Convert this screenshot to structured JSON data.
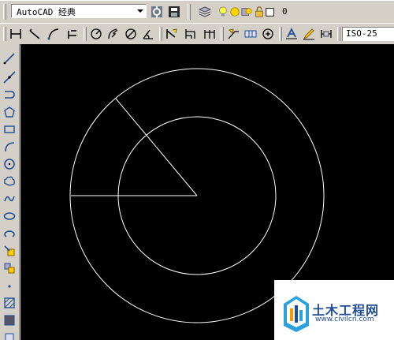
{
  "workspace": {
    "selected": "AutoCAD 经典"
  },
  "layer": {
    "current": "0"
  },
  "dimension": {
    "style": "ISO-25"
  },
  "watermark": {
    "title": "土木工程网",
    "url": "www.civilcn.com"
  },
  "colors": {
    "canvas": "#000000",
    "geometry": "#ffffff",
    "toolbar": "#d4d0c8",
    "icon_blue": "#1f4e96"
  }
}
